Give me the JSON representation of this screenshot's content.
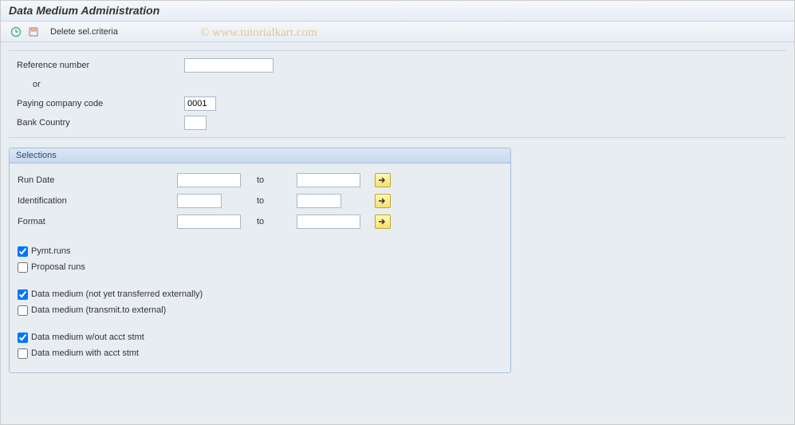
{
  "header": {
    "title": "Data Medium Administration"
  },
  "toolbar": {
    "delete_sel": "Delete sel.criteria"
  },
  "watermark": "© www.tutorialkart.com",
  "top": {
    "reference_label": "Reference number",
    "reference_value": "",
    "or_label": "or",
    "paying_cc_label": "Paying company code",
    "paying_cc_value": "0001",
    "bank_country_label": "Bank Country",
    "bank_country_value": ""
  },
  "group": {
    "title": "Selections",
    "to_label": "to",
    "rows": [
      {
        "label": "Run Date",
        "from": "",
        "to": ""
      },
      {
        "label": "Identification",
        "from": "",
        "to": ""
      },
      {
        "label": "Format",
        "from": "",
        "to": ""
      }
    ],
    "checks": {
      "pymt_runs": {
        "label": "Pymt.runs",
        "checked": true
      },
      "proposal_runs": {
        "label": "Proposal runs",
        "checked": false
      },
      "dm_not_transferred": {
        "label": "Data medium (not yet transferred externally)",
        "checked": true
      },
      "dm_transmit": {
        "label": "Data medium (transmit.to external)",
        "checked": false
      },
      "dm_without_stmt": {
        "label": "Data medium w/out acct stmt",
        "checked": true
      },
      "dm_with_stmt": {
        "label": "Data medium with acct stmt",
        "checked": false
      }
    }
  }
}
